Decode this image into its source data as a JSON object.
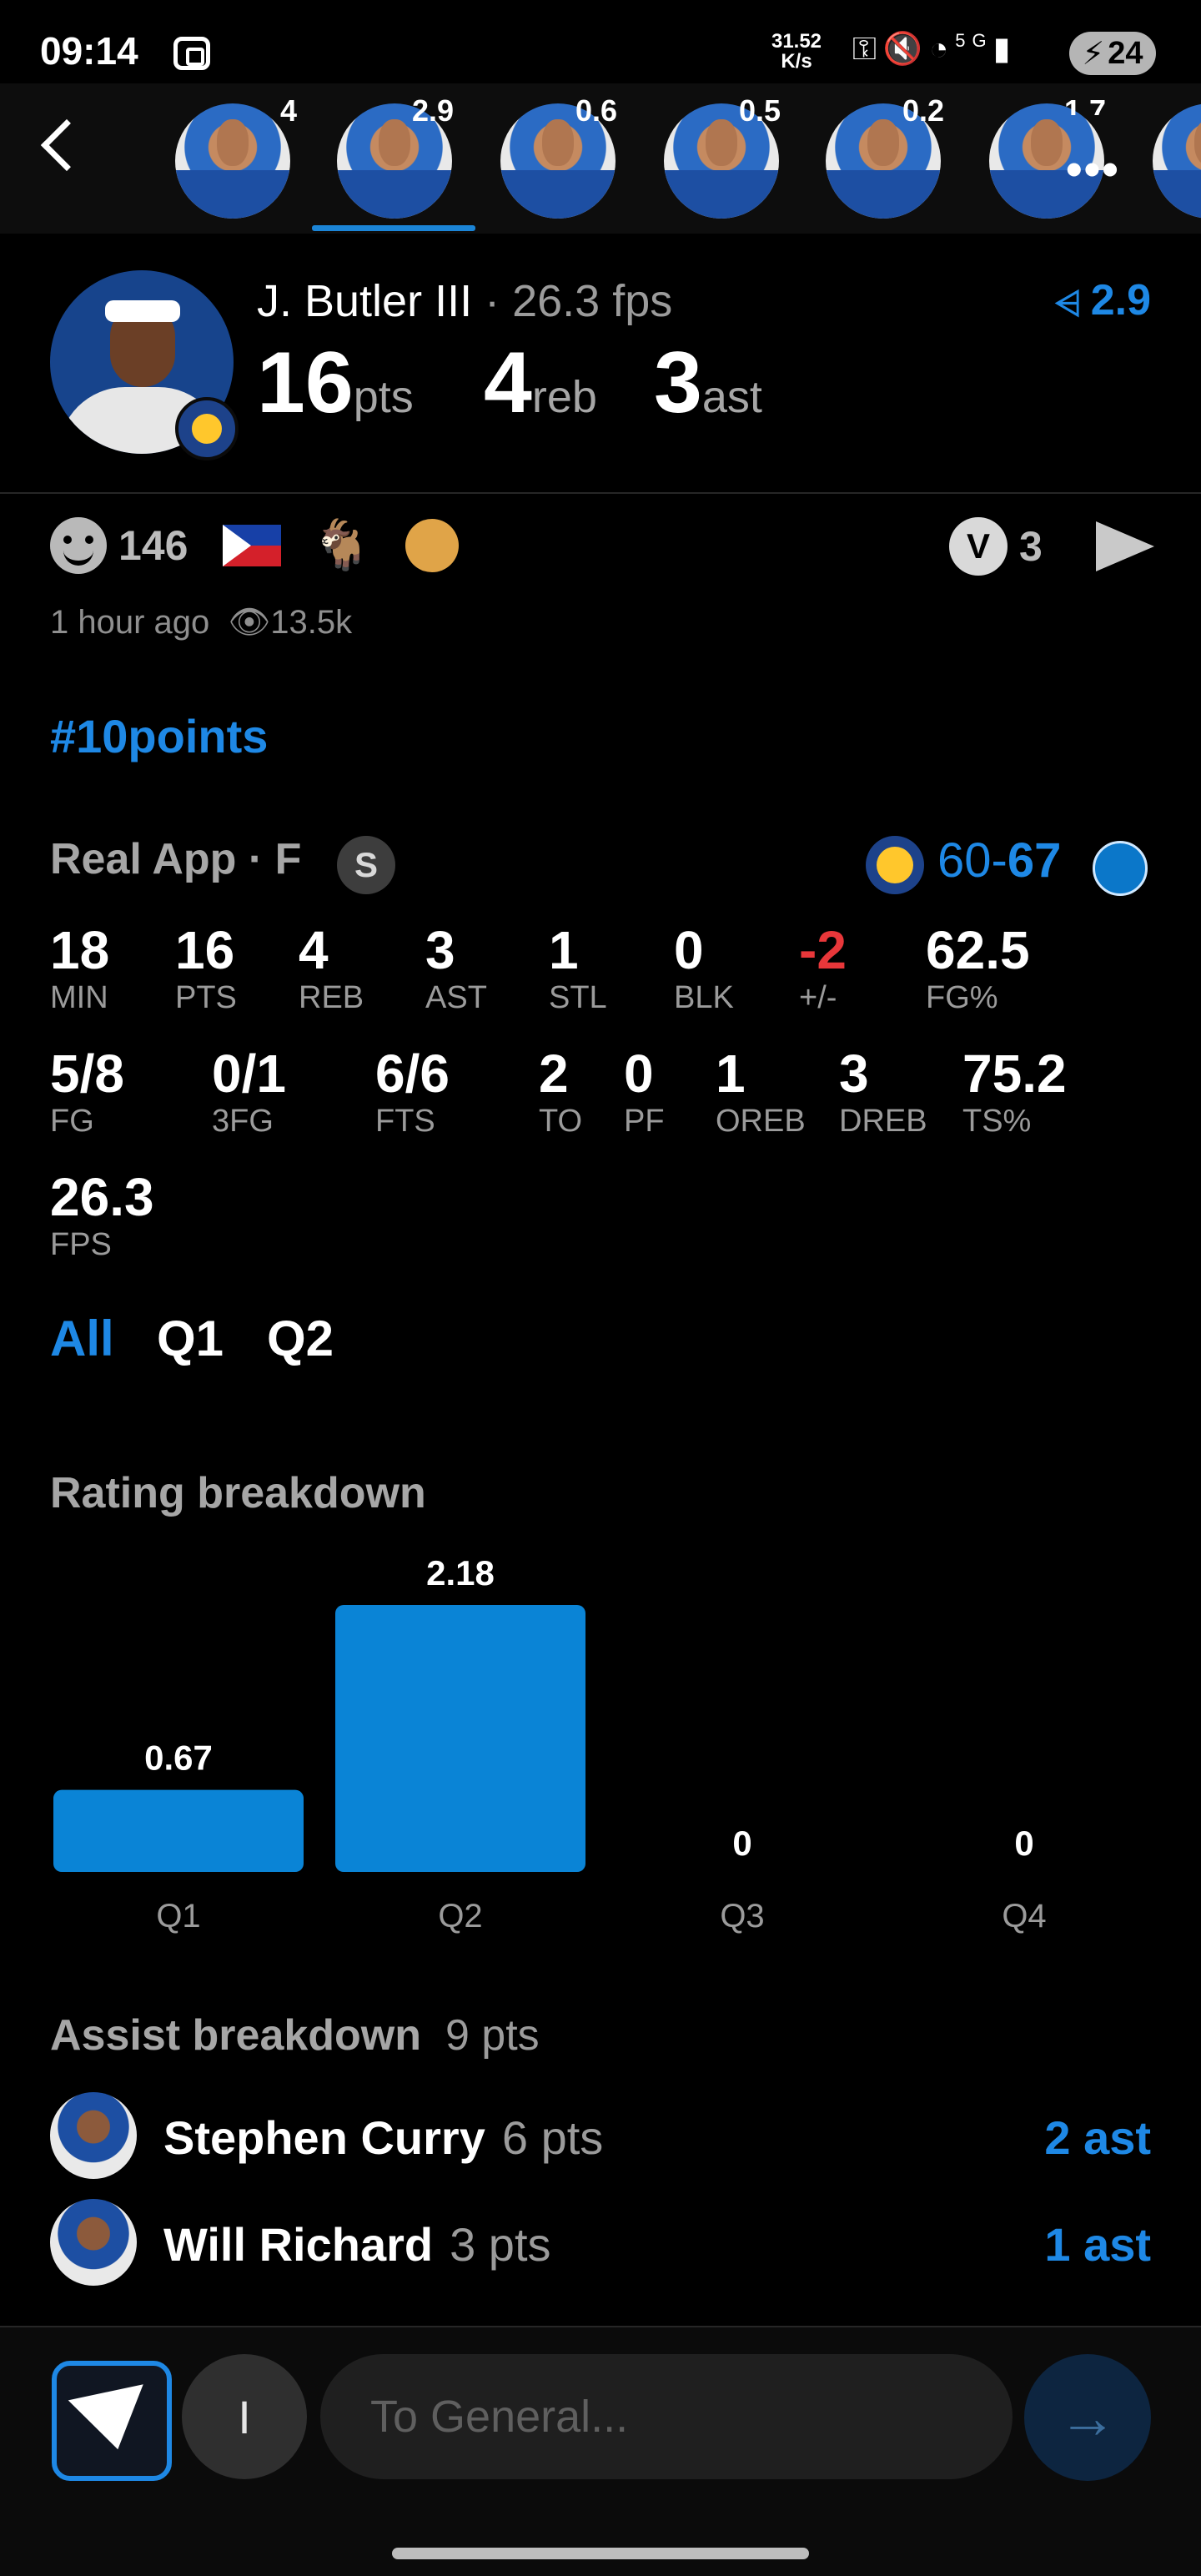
{
  "status_bar": {
    "time": "09:14",
    "net_speed_value": "31.52",
    "net_speed_unit": "K/s",
    "battery": "24",
    "network": "5G"
  },
  "player_strip": {
    "players": [
      {
        "rating": "4"
      },
      {
        "rating": "2.9",
        "selected": true
      },
      {
        "rating": "0.6"
      },
      {
        "rating": "0.5"
      },
      {
        "rating": "0.2"
      },
      {
        "rating": "1.7"
      }
    ]
  },
  "player": {
    "name": "J. Butler III",
    "fps": "· 26.3 fps",
    "pts": "16",
    "pts_unit": "pts",
    "reb": "4",
    "reb_unit": "reb",
    "ast": "3",
    "ast_unit": "ast",
    "rating": "2.9"
  },
  "reactions": {
    "smile_count": "146",
    "vote_count": "3"
  },
  "post": {
    "time_ago": "1 hour ago",
    "views": "13.5k",
    "hashtag": "#10points"
  },
  "game": {
    "source": "Real App · F",
    "badge": "S",
    "score_home": "60-",
    "score_away": "67"
  },
  "box": {
    "row1": [
      {
        "v": "18",
        "l": "MIN"
      },
      {
        "v": "16",
        "l": "PTS"
      },
      {
        "v": "4",
        "l": "REB"
      },
      {
        "v": "3",
        "l": "AST"
      },
      {
        "v": "1",
        "l": "STL"
      },
      {
        "v": "0",
        "l": "BLK"
      },
      {
        "v": "-2",
        "l": "+/-"
      },
      {
        "v": "62.5",
        "l": "FG%"
      }
    ],
    "row2": [
      {
        "v": "5/8",
        "l": "FG"
      },
      {
        "v": "0/1",
        "l": "3FG"
      },
      {
        "v": "6/6",
        "l": "FTS"
      },
      {
        "v": "2",
        "l": "TO"
      },
      {
        "v": "0",
        "l": "PF"
      },
      {
        "v": "1",
        "l": "OREB"
      },
      {
        "v": "3",
        "l": "DREB"
      },
      {
        "v": "75.2",
        "l": "TS%"
      }
    ],
    "row3": [
      {
        "v": "26.3",
        "l": "FPS"
      }
    ]
  },
  "quarter_tabs": [
    "All",
    "Q1",
    "Q2"
  ],
  "rating_title": "Rating breakdown",
  "chart_data": {
    "type": "bar",
    "categories": [
      "Q1",
      "Q2",
      "Q3",
      "Q4"
    ],
    "values": [
      0.67,
      2.18,
      0,
      0
    ],
    "labels": [
      "0.67",
      "2.18",
      "0",
      "0"
    ],
    "title": "Rating breakdown",
    "bar_color": "#0a84d6",
    "ylim": [
      0,
      2.18
    ]
  },
  "assists": {
    "title": "Assist breakdown",
    "total": "9 pts",
    "rows": [
      {
        "name": "Stephen Curry",
        "pts": "6 pts",
        "ast": "2 ast"
      },
      {
        "name": "Will Richard",
        "pts": "3 pts",
        "ast": "1 ast"
      }
    ]
  },
  "composer": {
    "placeholder": "To General...",
    "i_label": "I"
  },
  "colors": {
    "accent": "#1e88e5",
    "negative": "#e8373a",
    "background": "#000000"
  }
}
